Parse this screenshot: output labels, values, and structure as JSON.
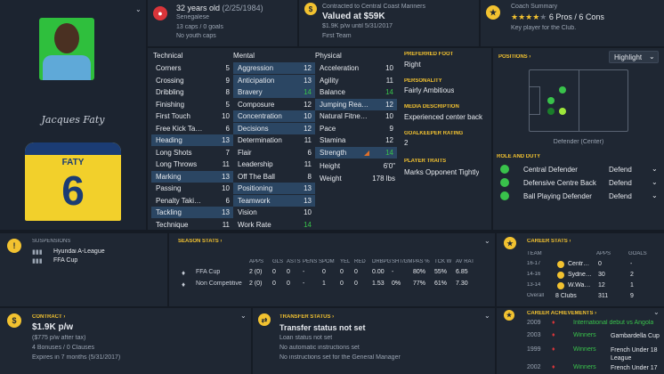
{
  "player": {
    "age_line": "32 years old",
    "dob": "(2/25/1984)",
    "nationality": "Senegalese",
    "caps": "13 caps / 0 goals",
    "youth": "No youth caps",
    "number": "6",
    "shirt_name": "FATY",
    "signature": "Jacques Faty"
  },
  "contract_header": {
    "line1": "Contracted to Central Coast Mariners",
    "value": "Valued at $59K",
    "wage": "$1.9K p/w until 5/31/2017",
    "squad": "First Team"
  },
  "coach": {
    "title": "Coach Summary",
    "stars": "★★★★",
    "half": "★",
    "summary": "6 Pros / 6 Cons",
    "note": "Key player for the Club."
  },
  "technical": {
    "title": "Technical",
    "rows": [
      [
        "Corners",
        "5"
      ],
      [
        "Crossing",
        "9"
      ],
      [
        "Dribbling",
        "8"
      ],
      [
        "Finishing",
        "5"
      ],
      [
        "First Touch",
        "10"
      ],
      [
        "Free Kick Ta…",
        "6"
      ],
      [
        "Heading",
        "13"
      ],
      [
        "Long Shots",
        "7"
      ],
      [
        "Long Throws",
        "11"
      ],
      [
        "Marking",
        "13"
      ],
      [
        "Passing",
        "10"
      ],
      [
        "Penalty Taki…",
        "6"
      ],
      [
        "Tackling",
        "13"
      ],
      [
        "Technique",
        "11"
      ]
    ]
  },
  "mental": {
    "title": "Mental",
    "rows": [
      [
        "Aggression",
        "12"
      ],
      [
        "Anticipation",
        "13"
      ],
      [
        "Bravery",
        "14"
      ],
      [
        "Composure",
        "12"
      ],
      [
        "Concentration",
        "10"
      ],
      [
        "Decisions",
        "12"
      ],
      [
        "Determination",
        "11"
      ],
      [
        "Flair",
        "6"
      ],
      [
        "Leadership",
        "11"
      ],
      [
        "Off The Ball",
        "8"
      ],
      [
        "Positioning",
        "13"
      ],
      [
        "Teamwork",
        "13"
      ],
      [
        "Vision",
        "10"
      ],
      [
        "Work Rate",
        "14"
      ]
    ]
  },
  "physical": {
    "title": "Physical",
    "rows": [
      [
        "Acceleration",
        "10"
      ],
      [
        "Agility",
        "11"
      ],
      [
        "Balance",
        "14"
      ],
      [
        "Jumping Rea…",
        "12"
      ],
      [
        "Natural Fitne…",
        "10"
      ],
      [
        "Pace",
        "9"
      ],
      [
        "Stamina",
        "12"
      ],
      [
        "Strength",
        "14"
      ]
    ],
    "height_label": "Height",
    "height": "6'0\"",
    "weight_label": "Weight",
    "weight": "178 lbs"
  },
  "info": {
    "foot_label": "PREFERRED FOOT",
    "foot": "Right",
    "pers_label": "PERSONALITY",
    "pers": "Fairly Ambitious",
    "media_label": "MEDIA DESCRIPTION",
    "media": "Experienced center back",
    "gk_label": "GOALKEEPER RATING",
    "gk": "2",
    "traits_label": "PLAYER TRAITS",
    "traits": "Marks Opponent Tightly"
  },
  "positions": {
    "title": "POSITIONS ›",
    "select": "Highlight",
    "role_caption": "Defender (Center)",
    "role_title": "ROLE AND DUTY",
    "roles": [
      [
        "Central Defender",
        "Defend"
      ],
      [
        "Defensive Centre Back",
        "Defend"
      ],
      [
        "Ball Playing Defender",
        "Defend"
      ]
    ]
  },
  "suspensions": {
    "title": "SUSPENSIONS",
    "rows": [
      "Hyundai A-League",
      "FFA Cup"
    ]
  },
  "season": {
    "title": "SEASON STATS ›",
    "headers": [
      "APPS",
      "GLS",
      "ASTS",
      "PENS S",
      "POM",
      "YEL",
      "RED",
      "DRBPG",
      "SHT/GM",
      "PAS %",
      "TCK W",
      "AV RAT"
    ],
    "rows": [
      {
        "name": "FFA Cup",
        "vals": [
          "2 (0)",
          "0",
          "0",
          "-",
          "0",
          "0",
          "0",
          "0.00",
          "-",
          "80%",
          "55%",
          "6.85"
        ]
      },
      {
        "name": "Non Competitive",
        "vals": [
          "2 (0)",
          "0",
          "0",
          "-",
          "1",
          "0",
          "0",
          "1.53",
          "0%",
          "77%",
          "61%",
          "7.30"
        ]
      }
    ]
  },
  "career": {
    "title": "CAREER STATS ›",
    "headers": [
      "TEAM",
      "APPS",
      "GOALS"
    ],
    "rows": [
      [
        "16-17",
        "Centr…",
        "0",
        "-"
      ],
      [
        "14-16",
        "Sydne…",
        "30",
        "2"
      ],
      [
        "13-14",
        "W.Wa…",
        "12",
        "1"
      ]
    ],
    "overall": [
      "Overall",
      "8 Clubs",
      "311",
      "9"
    ]
  },
  "contract": {
    "title": "CONTRACT ›",
    "wage": "$1.9K p/w",
    "after_tax": "($775 p/w after tax)",
    "bonuses": "4 Bonuses / 0 Clauses",
    "expires": "Expires in 7 months  (5/31/2017)"
  },
  "transfer": {
    "title": "TRANSFER STATUS ›",
    "status": "Transfer status not set",
    "loan": "Loan status not set",
    "auto": "No automatic instructions set",
    "instr": "No instructions set for the General Manager"
  },
  "achievements": {
    "title": "CAREER ACHIEVEMENTS ›",
    "rows": [
      [
        "2009",
        "International debut vs Angola",
        ""
      ],
      [
        "2003",
        "Winners",
        "Gambardella Cup"
      ],
      [
        "1999",
        "Winners",
        "French Under 18 League"
      ],
      [
        "2002",
        "Winners",
        "French Under 17"
      ]
    ]
  },
  "colors": {
    "accent": "#f2c230",
    "highlight": "#2b4663",
    "green": "#39c24b",
    "panel": "#1f2733"
  }
}
